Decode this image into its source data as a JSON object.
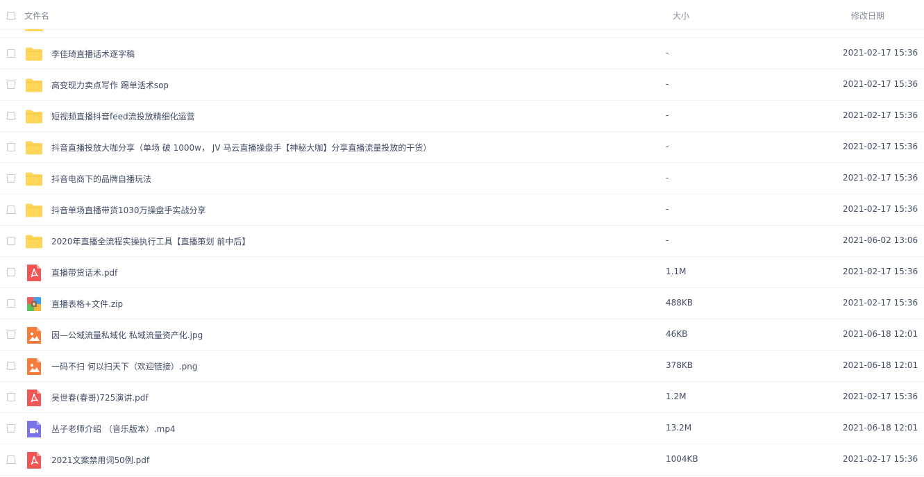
{
  "header": {
    "name_label": "文件名",
    "size_label": "大小",
    "date_label": "修改日期"
  },
  "files": [
    {
      "name": "李佳琦直播话术逐字稿",
      "size": "-",
      "date": "2021-02-17 15:36",
      "type": "folder"
    },
    {
      "name": "高变现力卖点写作 踢单活术sop",
      "size": "-",
      "date": "2021-02-17 15:36",
      "type": "folder"
    },
    {
      "name": "短视频直播抖音feed流投放精细化运营",
      "size": "-",
      "date": "2021-02-17 15:36",
      "type": "folder"
    },
    {
      "name": "抖音直播投放大咖分享（单场 破 1000w， JV 马云直播操盘手【神秘大咖】分享直播流量投放的干货）",
      "size": "-",
      "date": "2021-02-17 15:36",
      "type": "folder"
    },
    {
      "name": "抖音电商下的品牌自播玩法",
      "size": "-",
      "date": "2021-02-17 15:36",
      "type": "folder"
    },
    {
      "name": "抖音单场直播带货1030万操盘手实战分享",
      "size": "-",
      "date": "2021-02-17 15:36",
      "type": "folder"
    },
    {
      "name": "2020年直播全流程实操执行工具【直播策划 前中后】",
      "size": "-",
      "date": "2021-06-02 13:06",
      "type": "folder"
    },
    {
      "name": "直播带货话术.pdf",
      "size": "1.1M",
      "date": "2021-02-17 15:36",
      "type": "pdf"
    },
    {
      "name": "直播表格+文件.zip",
      "size": "488KB",
      "date": "2021-02-17 15:36",
      "type": "zip"
    },
    {
      "name": "因—公域流量私域化 私域流量资产化.jpg",
      "size": "46KB",
      "date": "2021-06-18 12:01",
      "type": "image"
    },
    {
      "name": "一码不扫 何以扫天下（欢迎链接）.png",
      "size": "378KB",
      "date": "2021-06-18 12:01",
      "type": "image"
    },
    {
      "name": "吴世春(春哥)725演讲.pdf",
      "size": "1.2M",
      "date": "2021-02-17 15:36",
      "type": "pdf"
    },
    {
      "name": "丛子老师介绍 （音乐版本）.mp4",
      "size": "13.2M",
      "date": "2021-06-18 12:01",
      "type": "video"
    },
    {
      "name": "2021文案禁用词50例.pdf",
      "size": "1004KB",
      "date": "2021-02-17 15:36",
      "type": "pdf"
    }
  ],
  "icon_names": {
    "folder": "folder-icon",
    "pdf": "pdf-file-icon",
    "zip": "zip-file-icon",
    "image": "image-file-icon",
    "video": "video-file-icon"
  },
  "colors": {
    "folder": "#ffd65c",
    "pdf": "#f05656",
    "image": "#f57c3d",
    "video": "#7b73e8"
  }
}
